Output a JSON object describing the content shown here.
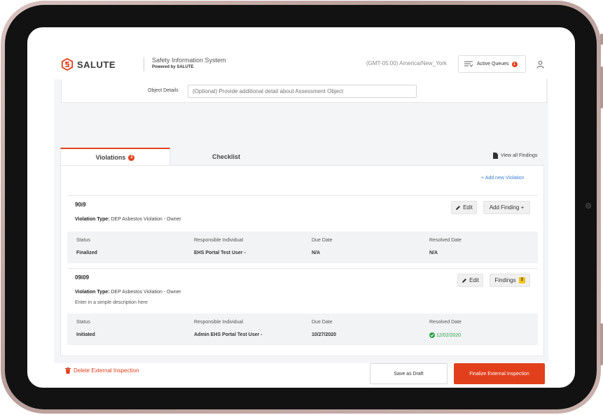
{
  "header": {
    "brand": "SALUTE",
    "system_title": "Safety Information System",
    "powered_by": "Powered by SALUTE",
    "timezone": "(GMT-05:00) America/New_York",
    "active_queues_label": "Active Queues",
    "active_queues_count": "1"
  },
  "object_details": {
    "label": "Object Details",
    "placeholder": "(Optional) Provide additional detail about Assessment Object"
  },
  "tabs": {
    "violations_label": "Violations",
    "violations_count": "2",
    "checklist_label": "Checklist",
    "view_all_findings": "View all Findings"
  },
  "add_new_violation": "+ Add new Violation",
  "columns": {
    "status": "Status",
    "responsible": "Responsible Individual",
    "due_date": "Due Date",
    "resolved_date": "Resolved Date"
  },
  "violations": [
    {
      "code": "90i9",
      "type_label": "Violation Type:",
      "type_value": "DEP Asbestos Violation - Owner",
      "description": "",
      "edit_label": "Edit",
      "findings_label": "Add Finding +",
      "findings_count": "",
      "status": "Finalized",
      "responsible": "EHS Portal Test User -",
      "due_date": "N/A",
      "resolved_date": "N/A"
    },
    {
      "code": "09i09",
      "type_label": "Violation Type:",
      "type_value": "DEP Asbestos Violation - Owner",
      "description": "Enter in a simple description here",
      "edit_label": "Edit",
      "findings_label": "Findings",
      "findings_count": "3",
      "status": "Initiated",
      "responsible": "Admin EHS Portal Test User -",
      "due_date": "10/27/2020",
      "resolved_date": "12/02/2020"
    }
  ],
  "footer": {
    "delete_label": "Delete External Inspection",
    "draft_label": "Save as Draft",
    "finalize_label": "Finalize External Inspection"
  },
  "colors": {
    "accent": "#e2401c",
    "link": "#3b82d6",
    "success": "#2aa346",
    "badge_yellow": "#f2c21a"
  }
}
